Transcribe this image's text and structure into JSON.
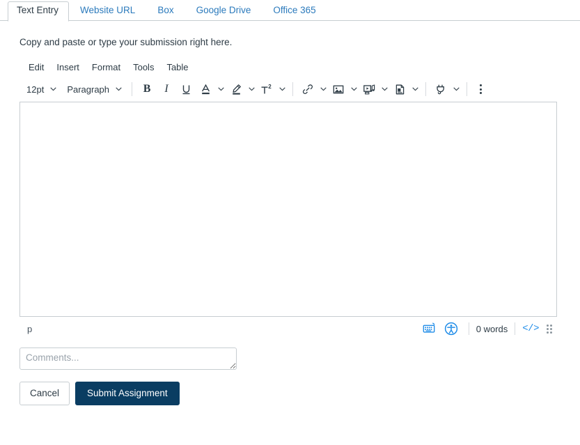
{
  "tabs": [
    {
      "label": "Text Entry",
      "active": true
    },
    {
      "label": "Website URL",
      "active": false
    },
    {
      "label": "Box",
      "active": false
    },
    {
      "label": "Google Drive",
      "active": false
    },
    {
      "label": "Office 365",
      "active": false
    }
  ],
  "prompt": "Copy and paste or type your submission right here.",
  "menubar": [
    {
      "label": "Edit"
    },
    {
      "label": "Insert"
    },
    {
      "label": "Format"
    },
    {
      "label": "Tools"
    },
    {
      "label": "Table"
    }
  ],
  "toolbar": {
    "font_size": "12pt",
    "block_format": "Paragraph",
    "bold_glyph": "B",
    "italic_glyph": "I",
    "icons": {
      "underline": "underline-icon",
      "text_color": "text-color-icon",
      "highlight": "highlight-color-icon",
      "superscript": "superscript-icon",
      "link": "link-icon",
      "image": "image-icon",
      "media": "media-icon",
      "document": "document-icon",
      "apps": "apps-plug-icon",
      "more": "more-options-icon"
    }
  },
  "editor": {
    "content": "",
    "element_path": "p",
    "word_count": "0 words",
    "code_label": "</>",
    "keyboard_icon": "keyboard-shortcuts-icon",
    "accessibility_icon": "accessibility-checker-icon",
    "resize_handle": "resize-handle"
  },
  "comments": {
    "value": "",
    "placeholder": "Comments..."
  },
  "actions": {
    "cancel_label": "Cancel",
    "submit_label": "Submit Assignment"
  },
  "colors": {
    "link_blue": "#2b7abc",
    "icon_blue": "#1f8ce8",
    "primary_navy": "#0a3d62",
    "text_dark": "#2d3b45",
    "border_gray": "#c7cdd1"
  }
}
